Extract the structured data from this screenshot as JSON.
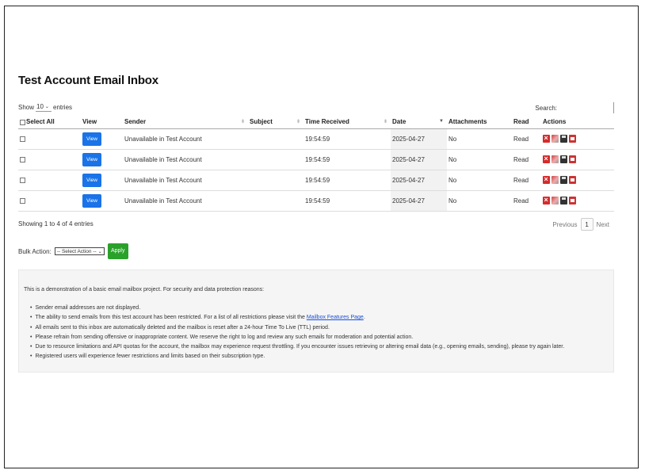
{
  "page": {
    "title": "Test Account Email Inbox"
  },
  "datatable": {
    "length": {
      "show_label": "Show",
      "value": "10",
      "entries_label": "entries"
    },
    "search": {
      "label": "Search:",
      "value": ""
    },
    "columns": {
      "select_all": "Select All",
      "view": "View",
      "sender": "Sender",
      "subject": "Subject",
      "time_received": "Time Received",
      "date": "Date",
      "attachments": "Attachments",
      "read": "Read",
      "actions": "Actions"
    },
    "rows": [
      {
        "view_label": "View",
        "sender": "Unavailable in Test Account",
        "subject": "",
        "time": "19:54:59",
        "date": "2025-04-27",
        "attachments": "No",
        "read": "Read"
      },
      {
        "view_label": "View",
        "sender": "Unavailable in Test Account",
        "subject": "",
        "time": "19:54:59",
        "date": "2025-04-27",
        "attachments": "No",
        "read": "Read"
      },
      {
        "view_label": "View",
        "sender": "Unavailable in Test Account",
        "subject": "",
        "time": "19:54:59",
        "date": "2025-04-27",
        "attachments": "No",
        "read": "Read"
      },
      {
        "view_label": "View",
        "sender": "Unavailable in Test Account",
        "subject": "",
        "time": "19:54:59",
        "date": "2025-04-27",
        "attachments": "No",
        "read": "Read"
      }
    ],
    "info": "Showing 1 to 4 of 4 entries",
    "pagination": {
      "previous": "Previous",
      "current": "1",
      "next": "Next"
    }
  },
  "bulk": {
    "label": "Bulk Action:",
    "select_value": "-- Select Action --",
    "apply_label": "Apply"
  },
  "notice": {
    "intro": "This is a demonstration of a basic email mailbox project. For security and data protection reasons:",
    "items": [
      "Sender email addresses are not displayed.",
      "The ability to send emails from this test account has been restricted. For a list of all restrictions please visit the",
      "All emails sent to this inbox are automatically deleted and the mailbox is reset after a 24-hour Time To Live (TTL) period.",
      "Please refrain from sending offensive or inappropriate content. We reserve the right to log and review any such emails for moderation and potential action.",
      "Due to resource limitations and API quotas for the account, the mailbox may experience request throttling. If you encounter issues retrieving or altering email data (e.g., opening emails, sending), please try again later.",
      "Registered users will experience fewer restrictions and limits based on their subscription type."
    ],
    "link_text": "Mailbox Features Page",
    "link_suffix": "."
  },
  "colors": {
    "view_button": "#1a73e8",
    "apply_button": "#2aa12a",
    "delete_icon": "#d62b2b",
    "link": "#1a4fd6"
  },
  "icons": {
    "row_actions": [
      "delete-icon",
      "flag-icon",
      "save-icon",
      "print-icon"
    ]
  }
}
